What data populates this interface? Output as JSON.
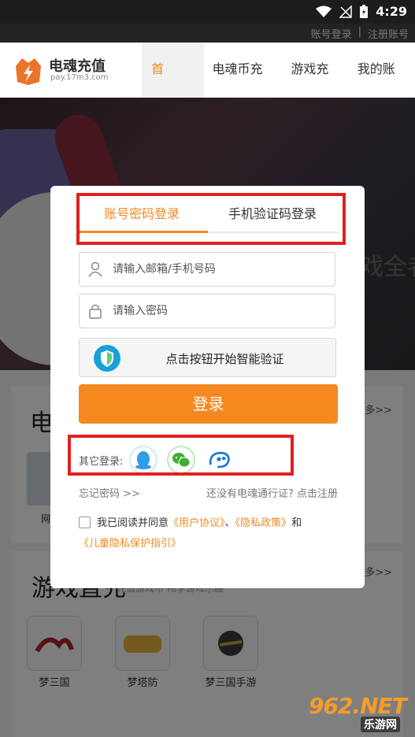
{
  "status_bar": {
    "time": "4:29"
  },
  "top_links": {
    "login": "账号登录",
    "separator": "|",
    "register": "注册账号"
  },
  "header": {
    "logo_name": "电魂充值",
    "logo_url": "pay.17m3.com",
    "nav": [
      "首页",
      "电魂币充值",
      "游戏充值",
      "我的账户"
    ]
  },
  "hero": {
    "partial_text": "戏全者"
  },
  "background": {
    "section1_heading": "电",
    "section1_more": "更多>>",
    "section1_thumb_label": "网",
    "section2_heading": "游戏直充",
    "section2_sub": "充值游戏币 畅享游戏乐趣",
    "section2_more": "更多>>",
    "games": [
      "梦三国",
      "梦塔防",
      "梦三国手游"
    ]
  },
  "modal": {
    "tabs": [
      "账号密码登录",
      "手机验证码登录"
    ],
    "account_placeholder": "请输入邮箱/手机号码",
    "password_placeholder": "请输入密码",
    "verify_text": "点击按钮开始智能验证",
    "login_button": "登录",
    "other_login_label": "其它登录:",
    "forgot_password": "忘记密码 >>",
    "register_prompt": "还没有电魂通行证? 点击注册",
    "agree_prefix": "我已阅读并同意",
    "user_agreement": "《用户协议》",
    "sep": "、",
    "privacy_policy": "《隐私政策》",
    "and": "和",
    "child_privacy": "《儿童隐私保护指引》"
  },
  "watermark": {
    "big": "962.NET",
    "small": "乐游网"
  },
  "colors": {
    "accent": "#f5891f",
    "annotation_red": "#e0211e"
  }
}
